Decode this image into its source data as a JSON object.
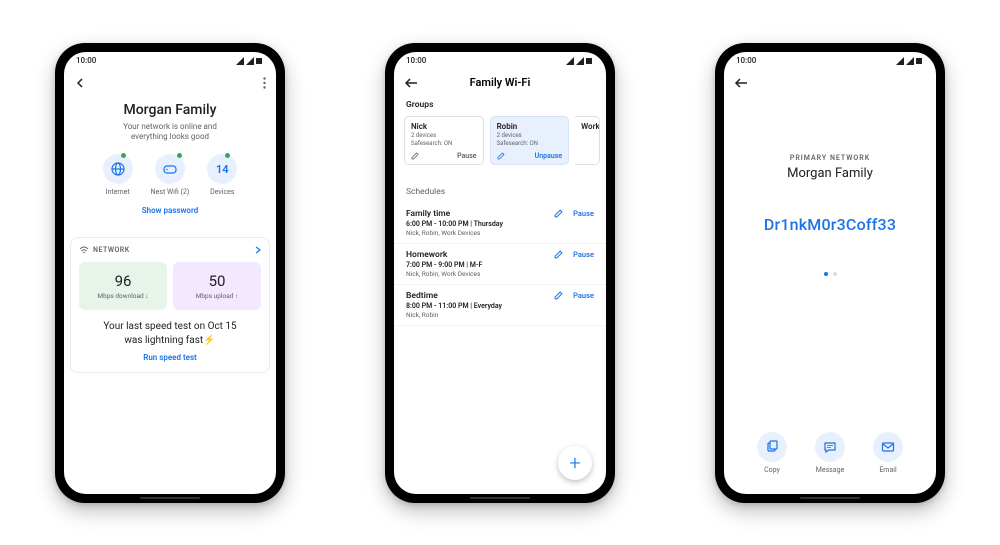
{
  "status_time": "10:00",
  "phone1": {
    "title": "Morgan Family",
    "subtitle_l1": "Your network is online and",
    "subtitle_l2": "everything looks good",
    "icons": {
      "internet": "Internet",
      "nest": "Nest Wifi (2)",
      "devices_count": "14",
      "devices_label": "Devices"
    },
    "show_password": "Show password",
    "network_label": "NETWORK",
    "download": {
      "value": "96",
      "unit": "Mbps download ↓"
    },
    "upload": {
      "value": "50",
      "unit": "Mbps upload ↑"
    },
    "speed_msg_l1": "Your last speed test on Oct 15",
    "speed_msg_l2": "was lightning fast⚡",
    "run_speed_test": "Run speed test"
  },
  "phone2": {
    "title": "Family Wi-Fi",
    "groups_label": "Groups",
    "groups": [
      {
        "name": "Nick",
        "devices": "2 devices",
        "safesearch": "Safesearch: ON",
        "action": "Pause",
        "paused": false
      },
      {
        "name": "Robin",
        "devices": "2 devices",
        "safesearch": "Safesearch: ON",
        "action": "Unpause",
        "paused": true
      },
      {
        "name": "Work",
        "devices": "",
        "safesearch": "",
        "action": "",
        "paused": false
      }
    ],
    "schedules_label": "Schedules",
    "schedules": [
      {
        "name": "Family time",
        "time": "6:00 PM - 10:00 PM  |  Thursday",
        "devices": "Nick, Robin, Work Devices"
      },
      {
        "name": "Homework",
        "time": "7:00 PM - 9:00 PM  |  M-F",
        "devices": "Nick, Robin, Work Devices"
      },
      {
        "name": "Bedtime",
        "time": "8:00 PM - 11:00 PM  |  Everyday",
        "devices": "Nick, Robin"
      }
    ],
    "edit": "✎",
    "pause": "Pause"
  },
  "phone3": {
    "overline": "PRIMARY NETWORK",
    "title": "Morgan Family",
    "password": "Dr1nkM0r3Coff33",
    "share": {
      "copy": "Copy",
      "message": "Message",
      "email": "Email"
    }
  }
}
